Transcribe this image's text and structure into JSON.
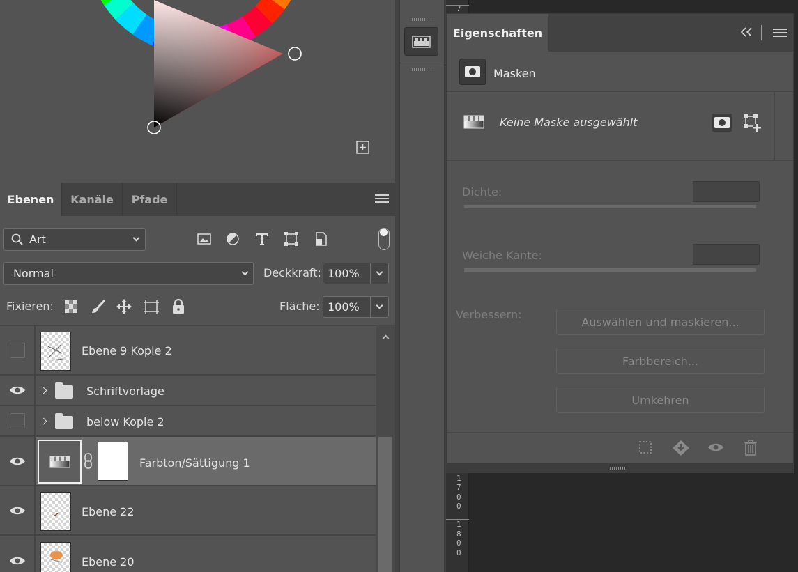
{
  "colors": {
    "panel": "#535353",
    "dark": "#282828",
    "selected_row": "#6a6a6a"
  },
  "layers_panel": {
    "tabs": [
      {
        "label": "Ebenen",
        "active": true
      },
      {
        "label": "Kanäle",
        "active": false
      },
      {
        "label": "Pfade",
        "active": false
      }
    ],
    "filter": {
      "value": "Art"
    },
    "filter_icons": [
      "image-filter-icon",
      "adjustment-filter-icon",
      "type-filter-icon",
      "shape-filter-icon",
      "smart-object-filter-icon"
    ],
    "blend_mode": "Normal",
    "opacity_label": "Deckkraft:",
    "opacity_value": "100%",
    "lock_label": "Fixieren:",
    "fill_label": "Fläche:",
    "fill_value": "100%",
    "layers": [
      {
        "name": "Ebene 9 Kopie 2",
        "visible": false,
        "type": "pixel"
      },
      {
        "name": "Schriftvorlage",
        "visible": true,
        "type": "group"
      },
      {
        "name": "below Kopie 2",
        "visible": false,
        "type": "group"
      },
      {
        "name": "Farbton/Sättigung 1",
        "visible": true,
        "type": "adjustment",
        "selected": true
      },
      {
        "name": "Ebene 22",
        "visible": true,
        "type": "pixel"
      },
      {
        "name": "Ebene 20",
        "visible": true,
        "type": "pixel"
      }
    ]
  },
  "properties_panel": {
    "title": "Eigenschaften",
    "section": "Masken",
    "no_mask_text": "Keine Maske ausgewählt",
    "density_label": "Dichte:",
    "feather_label": "Weiche Kante:",
    "refine_label": "Verbessern:",
    "buttons": {
      "select_and_mask": "Auswählen und maskieren...",
      "color_range": "Farbbereich...",
      "invert": "Umkehren"
    }
  },
  "ruler": {
    "top_digit": "7",
    "numbers": [
      {
        "digits": [
          "1",
          "7",
          "0",
          "0"
        ]
      },
      {
        "digits": [
          "1",
          "8",
          "0",
          "0"
        ]
      }
    ]
  }
}
